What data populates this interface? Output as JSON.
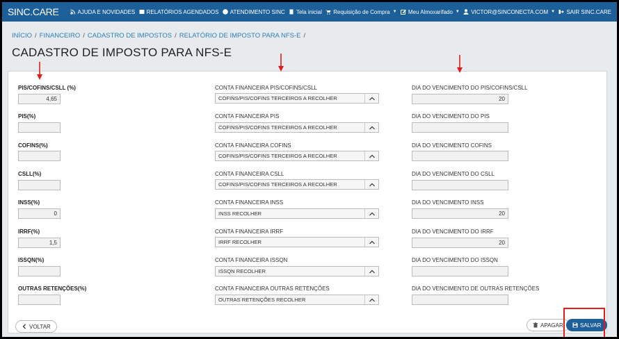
{
  "app": {
    "brand": "SINC.CARE",
    "nav": [
      {
        "label": "AJUDA E NOVIDADES",
        "icon": "rss-icon"
      },
      {
        "label": "RELATÓRIOS AGENDADOS",
        "icon": "newspaper-icon"
      },
      {
        "label": "ATENDIMENTO SINC",
        "icon": "question-icon"
      },
      {
        "label": "Tela inicial",
        "icon": "building-icon"
      },
      {
        "label": "Requisição de Compra",
        "icon": "cart-icon"
      },
      {
        "label": "Meu Almoxarifado",
        "icon": "edit-icon"
      },
      {
        "label": "VICTOR@SINCONECTA.COM",
        "icon": "user-icon"
      },
      {
        "label": "SAIR SINC.CARE",
        "icon": "signout-icon"
      }
    ]
  },
  "breadcrumb": [
    "INÍCIO",
    "FINANCEIRO",
    "CADASTRO DE IMPOSTOS",
    "RELATÓRIO DE IMPOSTO PARA NFS-E"
  ],
  "page_title": "CADASTRO DE IMPOSTO PARA NFS-E",
  "rows": [
    {
      "tax_label": "PIS/COFINS/CSLL (%)",
      "tax_value": "4,65",
      "account_label": "CONTA FINANCEIRA PIS/COFINS/CSLL",
      "account_value": "COFINS/PIS/COFINS TERCEIROS A RECOLHER",
      "due_label": "DIA DO VENCIMENTO DO PIS/COFINS/CSLL",
      "due_value": "20"
    },
    {
      "tax_label": "PIS(%)",
      "tax_value": "",
      "account_label": "CONTA FINANCEIRA PIS",
      "account_value": "COFINS/PIS/COFINS TERCEIROS A RECOLHER",
      "due_label": "DIA DO VENCIMENTO DO PIS",
      "due_value": ""
    },
    {
      "tax_label": "COFINS(%)",
      "tax_value": "",
      "account_label": "CONTA FINANCEIRA COFINS",
      "account_value": "COFINS/PIS/COFINS TERCEIROS A RECOLHER",
      "due_label": "DIA DO VENCIMENTO COFINS",
      "due_value": ""
    },
    {
      "tax_label": "CSLL(%)",
      "tax_value": "",
      "account_label": "CONTA FINANCEIRA CSLL",
      "account_value": "COFINS/PIS/COFINS TERCEIROS A RECOLHER",
      "due_label": "DIA DO VENCIMENTO DO CSLL",
      "due_value": ""
    },
    {
      "tax_label": "INSS(%)",
      "tax_value": "0",
      "account_label": "CONTA FINANCEIRA INSS",
      "account_value": "INSS RECOLHER",
      "due_label": "DIA DO VENCIMENTO INSS",
      "due_value": "20"
    },
    {
      "tax_label": "IRRF(%)",
      "tax_value": "1,5",
      "account_label": "CONTA FINANCEIRA IRRF",
      "account_value": "IRRF RECOLHER",
      "due_label": "DIA DO VENCIMENTO DO IRRF",
      "due_value": "20"
    },
    {
      "tax_label": "ISSQN(%)",
      "tax_value": "",
      "account_label": "CONTA FINANCEIRA ISSQN",
      "account_value": "ISSQN RECOLHER",
      "due_label": "DIA DO VENCIMENTO DO ISSQN",
      "due_value": ""
    },
    {
      "tax_label": "OUTRAS RETENÇÕES(%)",
      "tax_value": "",
      "account_label": "CONTA FINANCEIRA OUTRAS RETENÇÕES",
      "account_value": "OUTRAS RETENÇÕES RECOLHER",
      "due_label": "DIA DO VENCIMENTO DE OUTRAS RETENÇÕES",
      "due_value": ""
    }
  ],
  "buttons": {
    "back": "VOLTAR",
    "delete": "APAGAR",
    "save": "SALVAR"
  },
  "colors": {
    "topbar": "#1d5f99",
    "link": "#2e7db8",
    "annotation": "#e31b1b"
  }
}
